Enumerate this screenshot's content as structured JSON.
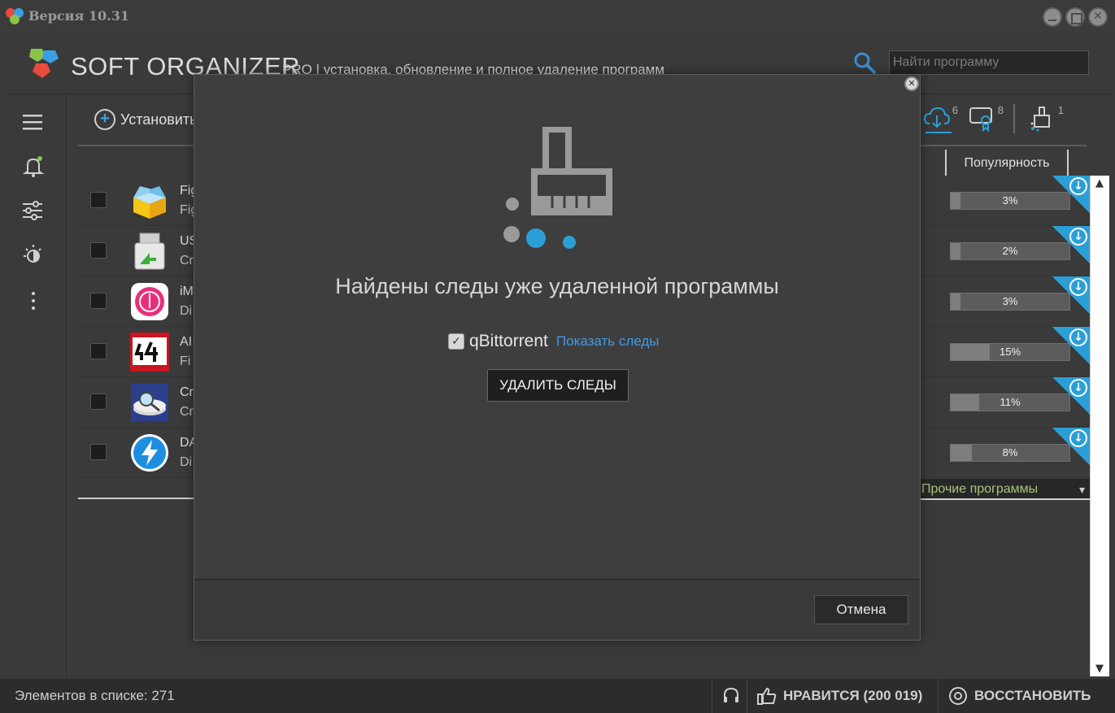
{
  "window": {
    "title": "Версия 10.31",
    "controls": [
      "minimize",
      "maximize",
      "close"
    ]
  },
  "header": {
    "brand": "SOFT ORGANIZER",
    "subtitle": "PRO | установка, обновление и полное удаление программ",
    "search_placeholder": "Найти программу"
  },
  "sidebar": {
    "items": [
      {
        "icon": "menu-icon"
      },
      {
        "icon": "bell-icon"
      },
      {
        "icon": "sliders-icon"
      },
      {
        "icon": "theme-icon"
      },
      {
        "icon": "more-icon"
      }
    ]
  },
  "toolbar": {
    "install_label": "Установить",
    "top_icons": [
      {
        "icon": "cloud-download-icon",
        "count": "6"
      },
      {
        "icon": "certificate-icon",
        "count": "8"
      },
      {
        "icon": "broom-icon",
        "count": "1"
      }
    ]
  },
  "table": {
    "popularity_header": "Популярность",
    "rows": [
      {
        "l1": "Fig",
        "l2": "Fig",
        "icon": "box-icon",
        "popularity": 0.03,
        "popularity_label": "3%"
      },
      {
        "l1": "US",
        "l2": "Cr",
        "icon": "usb-icon",
        "popularity": 0.02,
        "popularity_label": "2%"
      },
      {
        "l1": "iM",
        "l2": "Di",
        "icon": "imazing-icon",
        "popularity": 0.03,
        "popularity_label": "3%"
      },
      {
        "l1": "AI",
        "l2": "Fi",
        "icon": "aida64-icon",
        "popularity": 0.15,
        "popularity_label": "15%"
      },
      {
        "l1": "Cr",
        "l2": "Cr",
        "icon": "disk-search-icon",
        "popularity": 0.11,
        "popularity_label": "11%"
      },
      {
        "l1": "DA",
        "l2": "Di",
        "icon": "lightning-icon",
        "popularity": 0.08,
        "popularity_label": "8%"
      }
    ],
    "other_programs": "Прочие программы"
  },
  "status": {
    "count_label": "Элементов в списке: 271",
    "like_label": "НРАВИТСЯ (200 019)",
    "restore_label": "ВОССТАНОВИТЬ"
  },
  "modal": {
    "heading": "Найдены следы уже удаленной программы",
    "program_name": "qBittorrent",
    "program_checked": true,
    "show_traces_link": "Показать следы",
    "delete_button": "УДАЛИТЬ СЛЕДЫ",
    "cancel_button": "Отмена"
  },
  "colors": {
    "accent": "#2a9fd6",
    "link": "#3d9be8",
    "background": "#3a3a3a"
  }
}
